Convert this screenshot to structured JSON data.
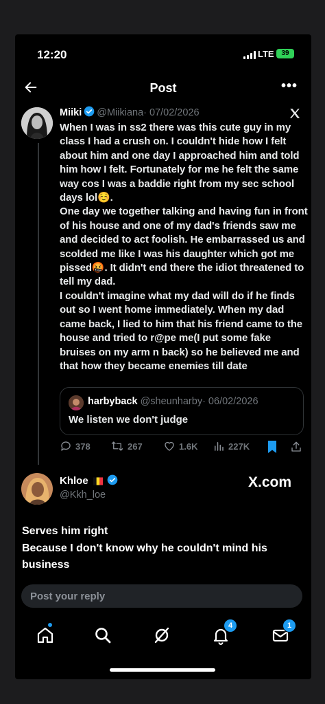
{
  "status": {
    "time": "12:20",
    "network": "LTE",
    "battery": "39"
  },
  "header": {
    "title": "Post"
  },
  "tweet": {
    "name": "Miiki",
    "handle": "@Miikiana",
    "date": "· 07/02/2026",
    "paragraphs": [
      "When I was in ss2 there was this cute guy in my class I had a crush on. I couldn't hide how I felt about him and one day I approached him and told him how I felt. Fortunately for me he felt the same way cos I was a baddie right from my sec school days lol☺️.",
      "One day we together talking and having fun in front of his house and one of my dad's friends saw me and decided to act foolish. He embarrassed us and scolded me like I was his daughter which got me pissed🤬. It didn't end there the idiot threatened to tell my dad.",
      "I couldn't imagine what my dad will do if he finds out so I went home immediately. When my dad came back, I lied to him that his friend came to the house and tried to r@pe me(I put some fake bruises on my arm n back) so he believed me and that how they became enemies till date"
    ],
    "quote": {
      "name": "harbyback",
      "handle": "@sheunharby",
      "date": "· 06/02/2026",
      "text": "We listen we don't judge"
    },
    "actions": {
      "replies": "378",
      "reposts": "267",
      "likes": "1.6K",
      "views": "227K"
    }
  },
  "reply": {
    "name": "Khloe",
    "handle": "@Kkh_loe",
    "watermark": "X.com",
    "lines": [
      "Serves him right",
      "Because I don't know why he couldn't mind his",
      "business"
    ]
  },
  "composer": {
    "placeholder": "Post your reply"
  },
  "nav": {
    "notifications_badge": "4",
    "messages_badge": "1"
  },
  "colors": {
    "accent": "#1d9bf0",
    "background": "#000000",
    "muted": "#71767b",
    "battery": "#30d158"
  },
  "icons": [
    "back-arrow-icon",
    "more-icon",
    "verified-icon",
    "x-logo-icon",
    "reply-icon",
    "repost-icon",
    "like-icon",
    "views-icon",
    "bookmark-icon",
    "share-icon",
    "home-icon",
    "search-icon",
    "grok-icon",
    "bell-icon",
    "mail-icon"
  ]
}
